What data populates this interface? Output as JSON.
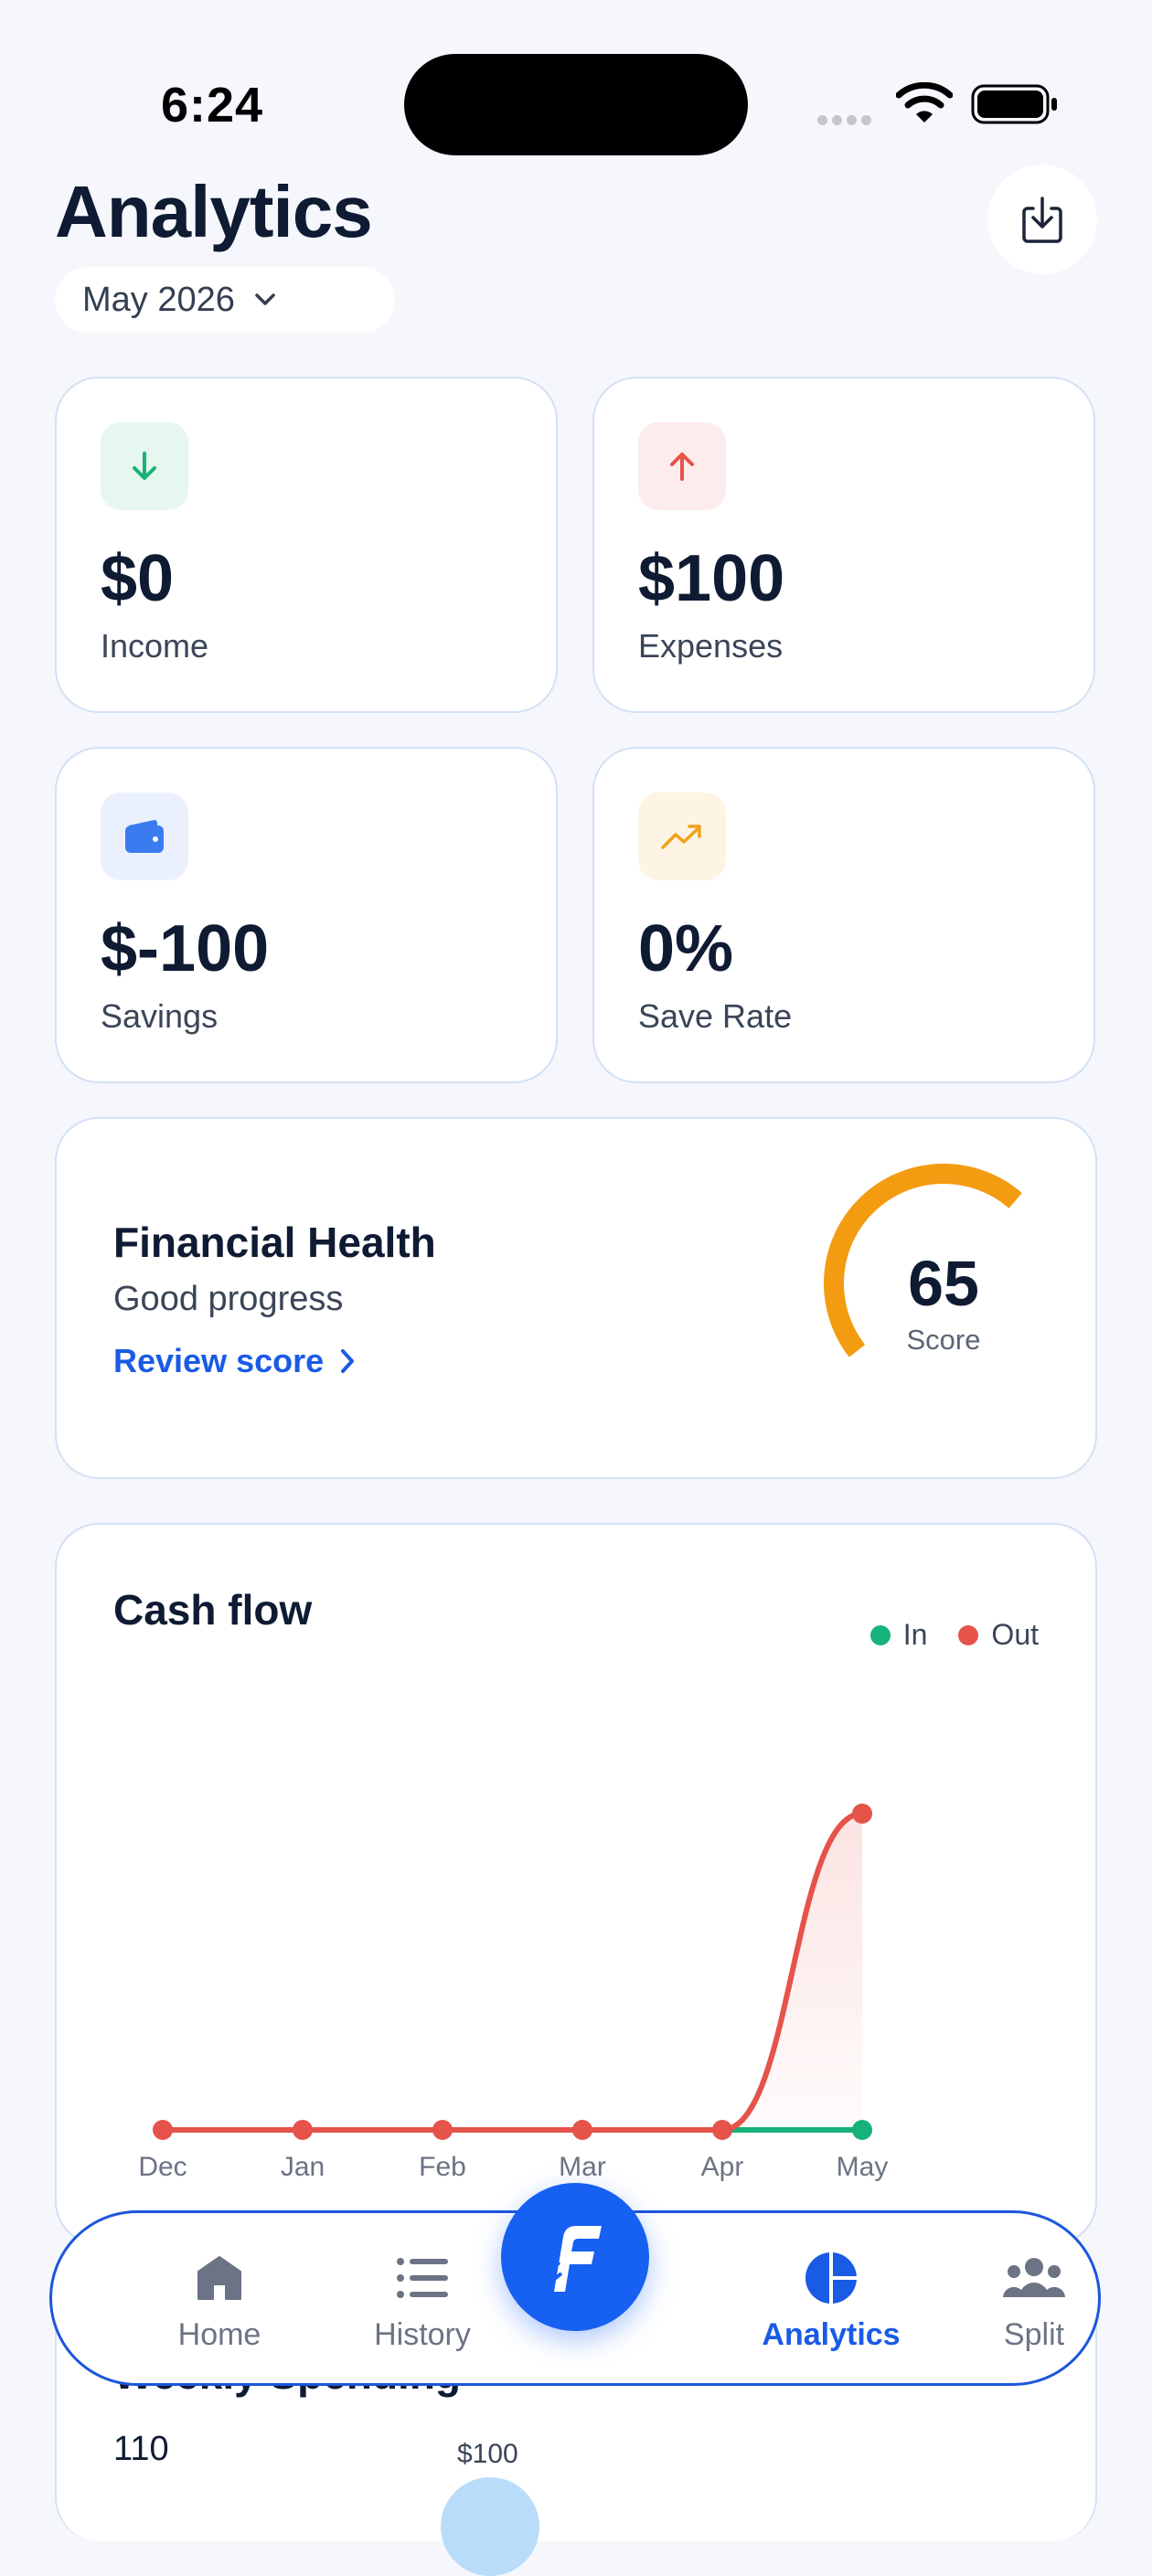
{
  "status_bar": {
    "time": "6:24"
  },
  "header": {
    "title": "Analytics",
    "month": "May 2026"
  },
  "stats": [
    {
      "value": "$0",
      "label": "Income",
      "icon": "arrow-down-icon",
      "color": "#16b27a"
    },
    {
      "value": "$100",
      "label": "Expenses",
      "icon": "arrow-up-icon",
      "color": "#e5534b"
    },
    {
      "value": "$-100",
      "label": "Savings",
      "icon": "wallet-icon",
      "color": "#3b7bf0"
    },
    {
      "value": "0%",
      "label": "Save Rate",
      "icon": "trending-up-icon",
      "color": "#f2a01c"
    }
  ],
  "health": {
    "title": "Financial Health",
    "subtitle": "Good progress",
    "link": "Review score",
    "score": "65",
    "score_label": "Score",
    "gauge_color": "#f39c12"
  },
  "cashflow": {
    "title": "Cash flow",
    "legend_in": "In",
    "legend_out": "Out",
    "in_color": "#16b27a",
    "out_color": "#e5534b"
  },
  "chart_data": {
    "type": "line",
    "title": "Cash flow",
    "categories": [
      "Dec",
      "Jan",
      "Feb",
      "Mar",
      "Apr",
      "May"
    ],
    "series": [
      {
        "name": "In",
        "values": [
          0,
          0,
          0,
          0,
          0,
          0
        ]
      },
      {
        "name": "Out",
        "values": [
          0,
          0,
          0,
          0,
          0,
          100
        ]
      }
    ],
    "ylim": [
      0,
      100
    ],
    "grid": false,
    "legend": "top-right"
  },
  "weekly": {
    "title": "Weekly Spending",
    "value": "110",
    "bar_label": "$100"
  },
  "tabs": [
    {
      "label": "Home",
      "icon": "home-icon"
    },
    {
      "label": "History",
      "icon": "list-icon"
    },
    {
      "label": "Analytics",
      "icon": "pie-chart-icon",
      "active": true
    },
    {
      "label": "Split",
      "icon": "people-icon"
    }
  ],
  "fab": {
    "icon": "app-logo-icon"
  }
}
